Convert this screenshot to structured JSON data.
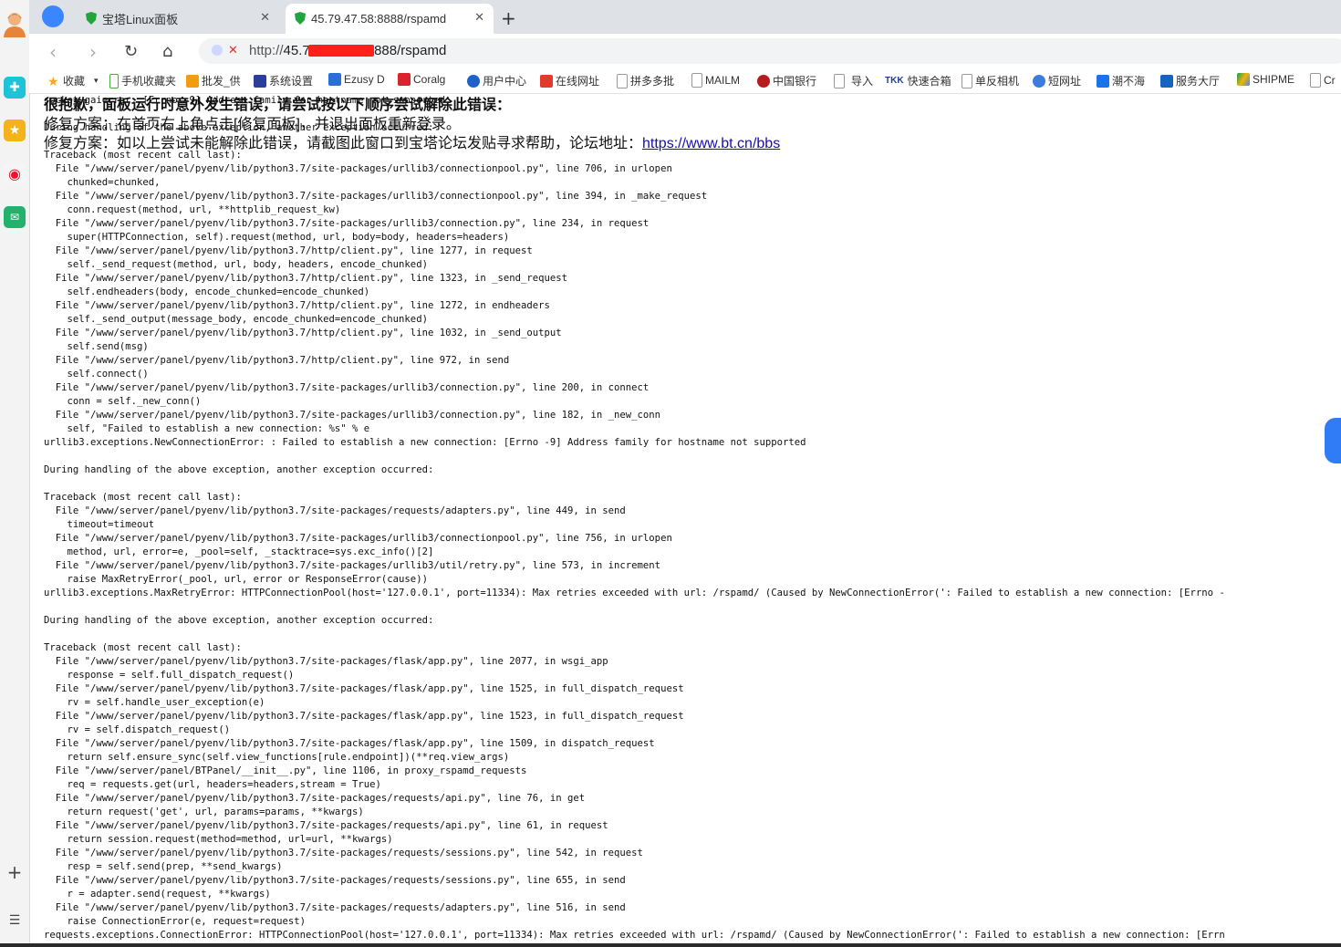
{
  "tabs": [
    {
      "title": "宝塔Linux面板",
      "active": false
    },
    {
      "title": "45.79.47.58:8888/rspamd",
      "active": true
    }
  ],
  "address": {
    "scheme": "http://",
    "host_start": "45.7",
    "host_end": "8888/rspamd"
  },
  "bookmarks": [
    "收藏",
    "手机收藏夹",
    "批发_供",
    "系统设置",
    "Ezusy D",
    "Coralg",
    "用户中心",
    "在线网址",
    "拼多多批",
    "MAILM",
    "中国银行",
    "导入",
    "快速合箱",
    "单反相机",
    "短网址",
    "潮不海",
    "服务大厅",
    "SHIPME",
    "Cr"
  ],
  "error_overlay": {
    "line1": "很抱歉，面板运行时意外发生错误，请尝试按以下顺序尝试解除此错误：",
    "line2": "修复方案：在首页右上角点击[修复面板]，并退出面板重新登录。",
    "line3_prefix": "修复方案：如以上尝试未能解除此错误，请截图此窗口到宝塔论坛发贴寻求帮助，论坛地址：",
    "link": "https://www.bt.cn/bbs"
  },
  "traceback": "socket.gaierror: [Errno -9] Address family for hostname not supported\n\nDuring handling of the above exception, another exception occurred:\n\nTraceback (most recent call last):\n  File \"/www/server/panel/pyenv/lib/python3.7/site-packages/urllib3/connectionpool.py\", line 706, in urlopen\n    chunked=chunked,\n  File \"/www/server/panel/pyenv/lib/python3.7/site-packages/urllib3/connectionpool.py\", line 394, in _make_request\n    conn.request(method, url, **httplib_request_kw)\n  File \"/www/server/panel/pyenv/lib/python3.7/site-packages/urllib3/connection.py\", line 234, in request\n    super(HTTPConnection, self).request(method, url, body=body, headers=headers)\n  File \"/www/server/panel/pyenv/lib/python3.7/http/client.py\", line 1277, in request\n    self._send_request(method, url, body, headers, encode_chunked)\n  File \"/www/server/panel/pyenv/lib/python3.7/http/client.py\", line 1323, in _send_request\n    self.endheaders(body, encode_chunked=encode_chunked)\n  File \"/www/server/panel/pyenv/lib/python3.7/http/client.py\", line 1272, in endheaders\n    self._send_output(message_body, encode_chunked=encode_chunked)\n  File \"/www/server/panel/pyenv/lib/python3.7/http/client.py\", line 1032, in _send_output\n    self.send(msg)\n  File \"/www/server/panel/pyenv/lib/python3.7/http/client.py\", line 972, in send\n    self.connect()\n  File \"/www/server/panel/pyenv/lib/python3.7/site-packages/urllib3/connection.py\", line 200, in connect\n    conn = self._new_conn()\n  File \"/www/server/panel/pyenv/lib/python3.7/site-packages/urllib3/connection.py\", line 182, in _new_conn\n    self, \"Failed to establish a new connection: %s\" % e\nurllib3.exceptions.NewConnectionError: : Failed to establish a new connection: [Errno -9] Address family for hostname not supported\n\nDuring handling of the above exception, another exception occurred:\n\nTraceback (most recent call last):\n  File \"/www/server/panel/pyenv/lib/python3.7/site-packages/requests/adapters.py\", line 449, in send\n    timeout=timeout\n  File \"/www/server/panel/pyenv/lib/python3.7/site-packages/urllib3/connectionpool.py\", line 756, in urlopen\n    method, url, error=e, _pool=self, _stacktrace=sys.exc_info()[2]\n  File \"/www/server/panel/pyenv/lib/python3.7/site-packages/urllib3/util/retry.py\", line 573, in increment\n    raise MaxRetryError(_pool, url, error or ResponseError(cause))\nurllib3.exceptions.MaxRetryError: HTTPConnectionPool(host='127.0.0.1', port=11334): Max retries exceeded with url: /rspamd/ (Caused by NewConnectionError(': Failed to establish a new connection: [Errno -\n\nDuring handling of the above exception, another exception occurred:\n\nTraceback (most recent call last):\n  File \"/www/server/panel/pyenv/lib/python3.7/site-packages/flask/app.py\", line 2077, in wsgi_app\n    response = self.full_dispatch_request()\n  File \"/www/server/panel/pyenv/lib/python3.7/site-packages/flask/app.py\", line 1525, in full_dispatch_request\n    rv = self.handle_user_exception(e)\n  File \"/www/server/panel/pyenv/lib/python3.7/site-packages/flask/app.py\", line 1523, in full_dispatch_request\n    rv = self.dispatch_request()\n  File \"/www/server/panel/pyenv/lib/python3.7/site-packages/flask/app.py\", line 1509, in dispatch_request\n    return self.ensure_sync(self.view_functions[rule.endpoint])(**req.view_args)\n  File \"/www/server/panel/BTPanel/__init__.py\", line 1106, in proxy_rspamd_requests\n    req = requests.get(url, headers=headers,stream = True)\n  File \"/www/server/panel/pyenv/lib/python3.7/site-packages/requests/api.py\", line 76, in get\n    return request('get', url, params=params, **kwargs)\n  File \"/www/server/panel/pyenv/lib/python3.7/site-packages/requests/api.py\", line 61, in request\n    return session.request(method=method, url=url, **kwargs)\n  File \"/www/server/panel/pyenv/lib/python3.7/site-packages/requests/sessions.py\", line 542, in request\n    resp = self.send(prep, **send_kwargs)\n  File \"/www/server/panel/pyenv/lib/python3.7/site-packages/requests/sessions.py\", line 655, in send\n    r = adapter.send(request, **kwargs)\n  File \"/www/server/panel/pyenv/lib/python3.7/site-packages/requests/adapters.py\", line 516, in send\n    raise ConnectionError(e, request=request)\nrequests.exceptions.ConnectionError: HTTPConnectionPool(host='127.0.0.1', port=11334): Max retries exceeded with url: /rspamd/ (Caused by NewConnectionError(': Failed to establish a new connection: [Errn",
  "colors": {
    "link": "#1a0dab",
    "active_tab": "#ffffff",
    "tabbar": "#dee1e6",
    "redaction": "#ff1f1f"
  },
  "icons": {
    "tab_favicon": "shield-icon",
    "sidebar": [
      "avatar",
      "health-icon",
      "star-icon",
      "weibo-icon",
      "mail-icon",
      "plus-icon",
      "list-icon"
    ]
  }
}
